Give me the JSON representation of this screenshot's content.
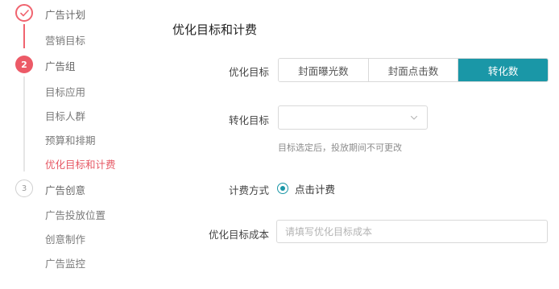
{
  "sidebar": {
    "steps": [
      {
        "label": "广告计划",
        "status": "done",
        "marker": "check-icon"
      },
      {
        "label": "广告组",
        "status": "active",
        "marker": "2"
      },
      {
        "label": "广告创意",
        "status": "todo",
        "marker": "3"
      }
    ],
    "plan_items": [
      "营销目标"
    ],
    "group_items": [
      "目标应用",
      "目标人群",
      "预算和排期",
      "优化目标和计费"
    ],
    "creative_items": [
      "广告投放位置",
      "创意制作",
      "广告监控"
    ],
    "active_item": "优化目标和计费"
  },
  "form": {
    "section_title": "优化目标和计费",
    "optimize_goal": {
      "label": "优化目标",
      "options": [
        "封面曝光数",
        "封面点击数",
        "转化数"
      ],
      "selected": "转化数"
    },
    "conversion_goal": {
      "label": "转化目标",
      "value": "",
      "hint": "目标选定后，投放期间不可更改"
    },
    "billing": {
      "label": "计费方式",
      "option": "点击计费"
    },
    "cost": {
      "label": "优化目标成本",
      "placeholder": "请填写优化目标成本",
      "value": ""
    }
  },
  "colors": {
    "accent_red": "#ec5a67",
    "accent_teal": "#1a97a7"
  }
}
